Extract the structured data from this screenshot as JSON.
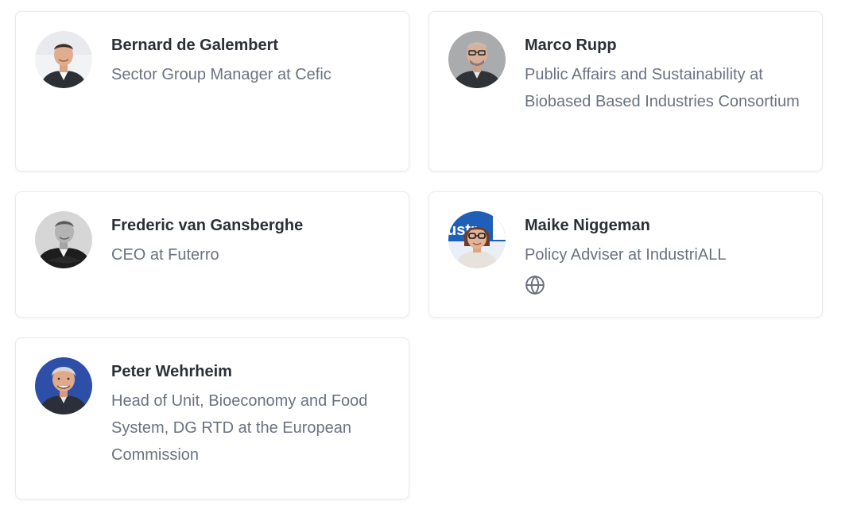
{
  "speakers": [
    {
      "name": "Bernard de Galembert",
      "role": "Sector Group Manager at Cefic",
      "avatar": "portrait-photo",
      "website": false
    },
    {
      "name": "Marco Rupp",
      "role": "Public Affairs and Sustainability at Biobased Based Industries Consortium",
      "avatar": "portrait-photo",
      "website": false
    },
    {
      "name": "Frederic van Gansberghe",
      "role": "CEO at Futerro",
      "avatar": "portrait-photo",
      "website": false
    },
    {
      "name": "Maike Niggeman",
      "role": "Policy Adviser at IndustriALL",
      "avatar": "portrait-photo",
      "website": true,
      "website_icon": "globe-icon"
    },
    {
      "name": "Peter Wehrheim",
      "role": "Head of Unit, Bioeconomy and Food System, DG RTD at the European Commission",
      "avatar": "portrait-photo",
      "website": false
    }
  ],
  "colors": {
    "name_text": "#2b2f36",
    "role_text": "#6b7280",
    "card_border": "#e9ebee",
    "icon": "#6b7280"
  }
}
